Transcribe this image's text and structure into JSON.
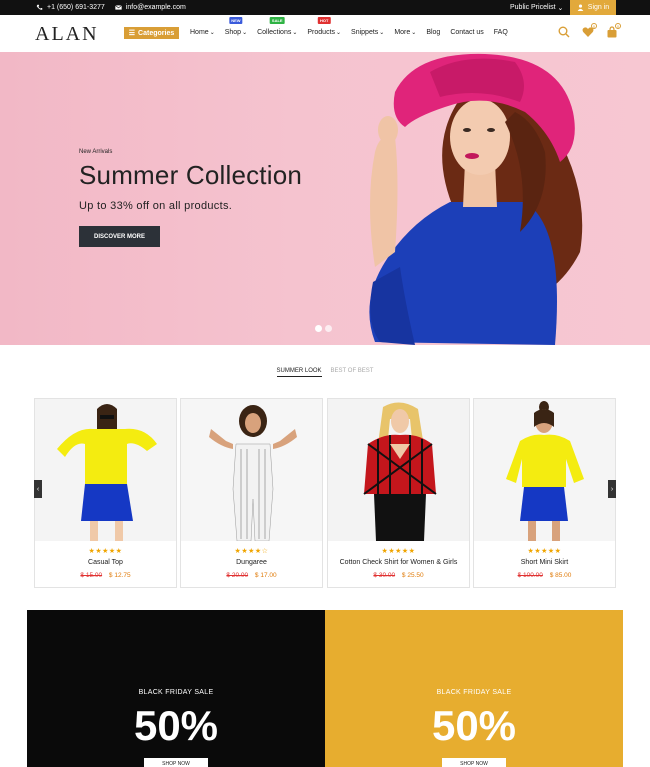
{
  "topbar": {
    "phone": "+1 (650) 691-3277",
    "email": "info@example.com",
    "pricelist": "Public Pricelist",
    "signin": "Sign in"
  },
  "header": {
    "logo": "ALAN",
    "categories_label": "Categories",
    "nav": [
      {
        "label": "Home",
        "dropdown": true,
        "badge": ""
      },
      {
        "label": "Shop",
        "dropdown": true,
        "badge": "NEW"
      },
      {
        "label": "Collections",
        "dropdown": true,
        "badge": "SALE"
      },
      {
        "label": "Products",
        "dropdown": true,
        "badge": "HOT"
      },
      {
        "label": "Snippets",
        "dropdown": true,
        "badge": ""
      },
      {
        "label": "More",
        "dropdown": true,
        "badge": ""
      },
      {
        "label": "Blog",
        "dropdown": false,
        "badge": ""
      },
      {
        "label": "Contact us",
        "dropdown": false,
        "badge": ""
      },
      {
        "label": "FAQ",
        "dropdown": false,
        "badge": ""
      }
    ],
    "wishlist_count": "0",
    "cart_count": "0"
  },
  "hero": {
    "tag": "New Arrivals",
    "title": "Summer Collection",
    "subtitle": "Up to 33% off on all products.",
    "button": "DISCOVER MORE"
  },
  "tabs": [
    "SUMMER LOOK",
    "BEST OF BEST"
  ],
  "products": [
    {
      "name": "Casual Top",
      "stars": "★★★★★",
      "old_price": "$ 15.00",
      "price": "$ 12.75"
    },
    {
      "name": "Dungaree",
      "stars": "★★★★☆",
      "old_price": "$ 20.00",
      "price": "$ 17.00"
    },
    {
      "name": "Cotton Check Shirt for Women & Girls",
      "stars": "★★★★★",
      "old_price": "$ 30.00",
      "price": "$ 25.50"
    },
    {
      "name": "Short Mini Skirt",
      "stars": "★★★★★",
      "old_price": "$ 100.00",
      "price": "$ 85.00"
    }
  ],
  "promos": [
    {
      "title": "BLACK FRIDAY SALE",
      "percent": "50%",
      "button": "SHOP NOW",
      "bg": "#0a0a0a"
    },
    {
      "title": "BLACK FRIDAY SALE",
      "percent": "50%",
      "button": "SHOP NOW",
      "bg": "#e7ad2f"
    }
  ],
  "colors": {
    "accent": "#d99e36",
    "hero_bg": "#f5c3cf",
    "dark": "#2c3138"
  }
}
